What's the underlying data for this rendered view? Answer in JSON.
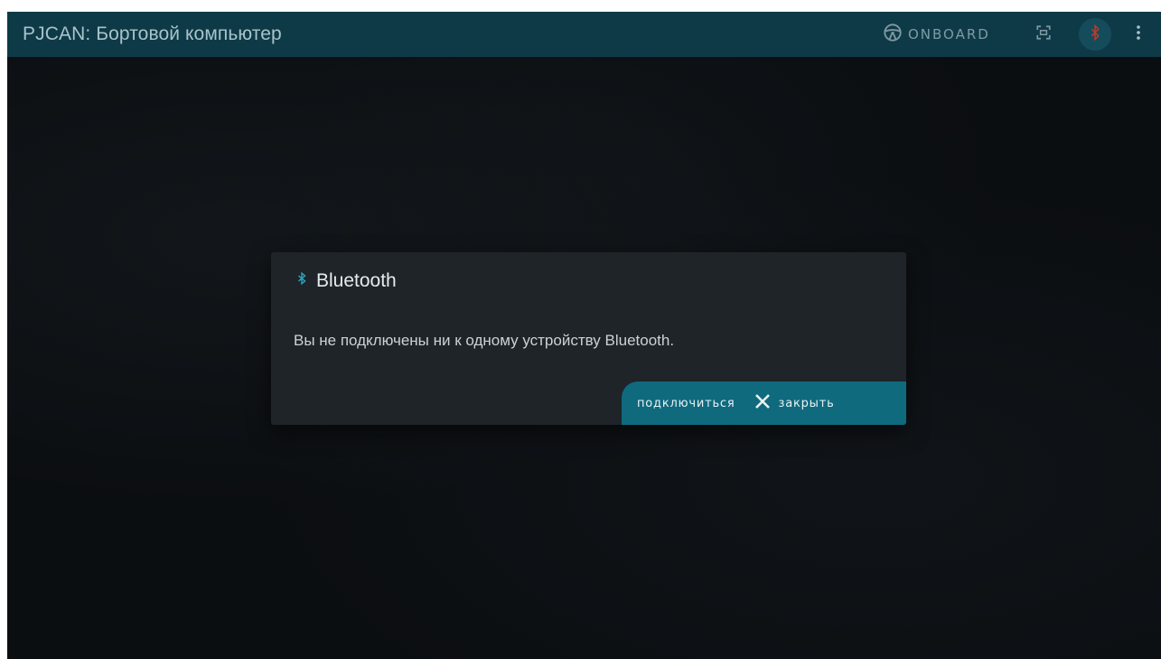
{
  "toolbar": {
    "title": "PJCAN: Бортовой компьютер",
    "onboard_label": "ONBOARD",
    "icons": {
      "steering": "steering-wheel-icon",
      "fullscreen": "fullscreen-icon",
      "bluetooth": "bluetooth-disabled-icon",
      "menu": "more-vert-icon"
    }
  },
  "dialog": {
    "icon": "bluetooth-icon",
    "title": "Bluetooth",
    "message": "Вы не подключены ни к одному устройству Bluetooth.",
    "connect_label": "подключиться",
    "close_label": "закрыть",
    "close_icon": "close-icon"
  },
  "colors": {
    "toolbar_bg": "#0e3a47",
    "accent": "#0f6a7e",
    "bluetooth_icon": "#2aa3c2",
    "bluetooth_disabled": "#c0392b",
    "background": "#0b0e11",
    "dialog_bg": "#1f2428"
  }
}
